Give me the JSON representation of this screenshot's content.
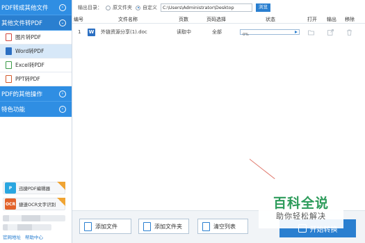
{
  "sidebar": {
    "categories": [
      {
        "label": "PDF转成其他文件"
      },
      {
        "label": "其他文件转PDF"
      },
      {
        "label": "PDF的其他操作"
      },
      {
        "label": "特色功能"
      }
    ],
    "sub_items": [
      {
        "label": "图片转PDF",
        "icon": "image-file-icon"
      },
      {
        "label": "Word转PDF",
        "icon": "word-file-icon"
      },
      {
        "label": "Excel转PDF",
        "icon": "excel-file-icon"
      },
      {
        "label": "PPT转PDF",
        "icon": "ppt-file-icon"
      }
    ],
    "promos": [
      {
        "label": "迅捷PDF编辑器",
        "icon_text": "P"
      },
      {
        "label": "捷速OCR文字识别",
        "icon_text": "OCR"
      }
    ],
    "footer": {
      "link1": "官网地址",
      "link2": "帮助中心"
    }
  },
  "output": {
    "label": "输出目录：",
    "option_original": "原文件夹",
    "option_custom": "自定义",
    "path": "C:\\Users\\Administrator\\Desktop",
    "browse_label": "浏览"
  },
  "table": {
    "headers": {
      "num": "编号",
      "name": "文件名称",
      "pages": "页数",
      "page_select": "页码选择",
      "status": "状态",
      "open": "打开",
      "output": "输出",
      "remove": "移除"
    },
    "rows": [
      {
        "num": "1",
        "type_icon": "W",
        "name": "外链资源分享(1).doc",
        "pages": "读取中",
        "page_select": "全部",
        "progress": "0%"
      }
    ]
  },
  "buttons": {
    "add_file": "添加文件",
    "add_folder": "添加文件夹",
    "clear_list": "清空列表",
    "start": "开始转换"
  },
  "watermark": {
    "title": "百科全说",
    "subtitle": "助你轻松解决"
  },
  "colors": {
    "accent": "#2a7fd0",
    "sidebar_header": "#2f8ee3",
    "watermark": "#2c9b5a"
  }
}
